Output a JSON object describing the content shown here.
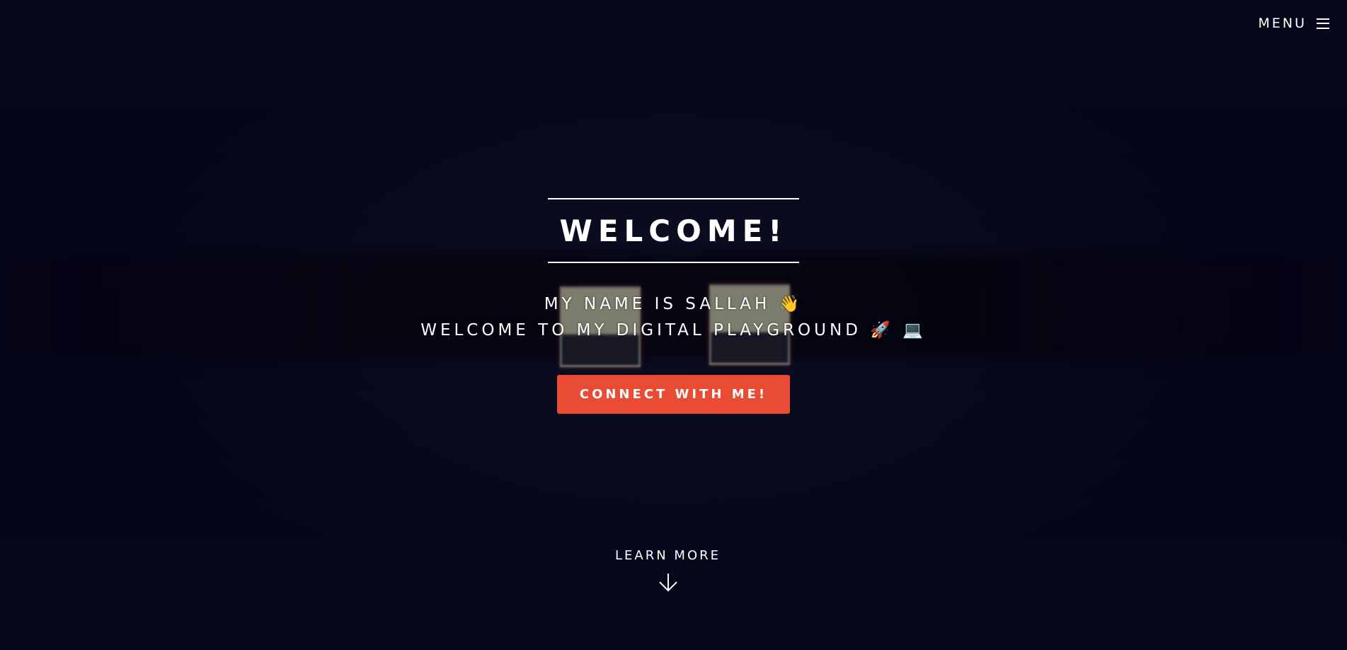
{
  "header": {
    "menu_label": "MENU",
    "menu_icon": "hamburger-icon"
  },
  "hero": {
    "title": "WELCOME!",
    "subtitle_line1": "MY NAME IS SALLAH 👋",
    "subtitle_line2": "WELCOME TO MY DIGITAL PLAYGROUND 🚀 💻",
    "cta_label": "CONNECT WITH ME!"
  },
  "footer": {
    "learn_more_label": "LEARN MORE",
    "learn_more_icon": "arrow-down-icon"
  },
  "colors": {
    "background": "#06061a",
    "accent": "#e94b35",
    "text": "#ffffff"
  }
}
